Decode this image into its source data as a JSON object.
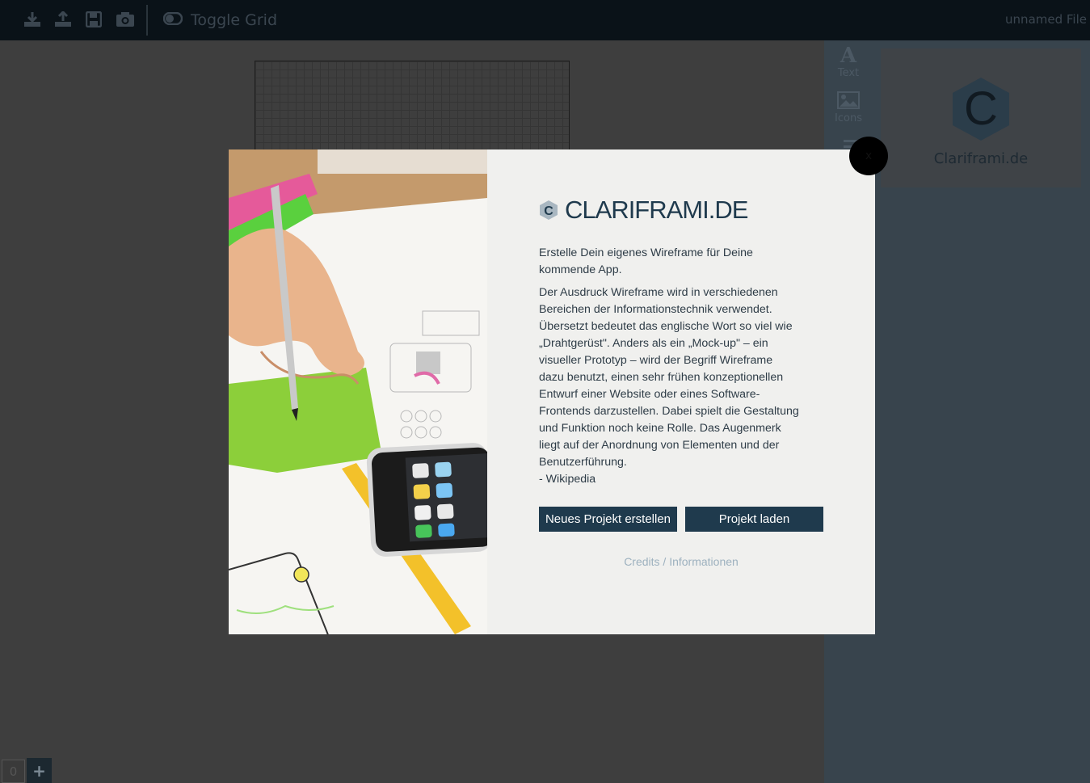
{
  "toolbar": {
    "toggle_grid_label": "Toggle Grid",
    "file_name": "unnamed File",
    "icons": [
      "download-icon",
      "upload-icon",
      "save-icon",
      "camera-icon",
      "toggle-icon"
    ]
  },
  "tools": {
    "text_label": "Text",
    "icons_label": "Icons"
  },
  "logo_card": {
    "letter": "C",
    "name": "Clariframi.de"
  },
  "pages": {
    "current": "0",
    "add_symbol": "+"
  },
  "modal": {
    "close_label": "x",
    "title": "CLARIFRAMI.DE",
    "logo_letter": "C",
    "intro": "Erstelle Dein eigenes Wireframe für Deine\nkommende App.",
    "body": "Der Ausdruck Wireframe wird in verschiedenen\nBereichen der Informationstechnik verwendet.\nÜbersetzt bedeutet das englische Wort so viel wie\n„Drahtgerüst\". Anders als ein „Mock-up\" – ein\nvisueller Prototyp – wird der Begriff Wireframe\ndazu benutzt, einen sehr frühen konzeptionellen\nEntwurf einer Website oder eines Software-\nFrontends darzustellen. Dabei spielt die Gestaltung\nund Funktion noch keine Rolle. Das Augenmerk\nliegt auf der Anordnung von Elementen und der\nBenutzerführung.\n- Wikipedia",
    "new_project_label": "Neues Projekt erstellen",
    "load_project_label": "Projekt laden",
    "credits_label": "Credits / Informationen"
  },
  "colors": {
    "brand": "#1f3a4d",
    "topbar": "#0a1218",
    "modal_bg": "#f0f0ee",
    "credits": "#9db1bf"
  }
}
